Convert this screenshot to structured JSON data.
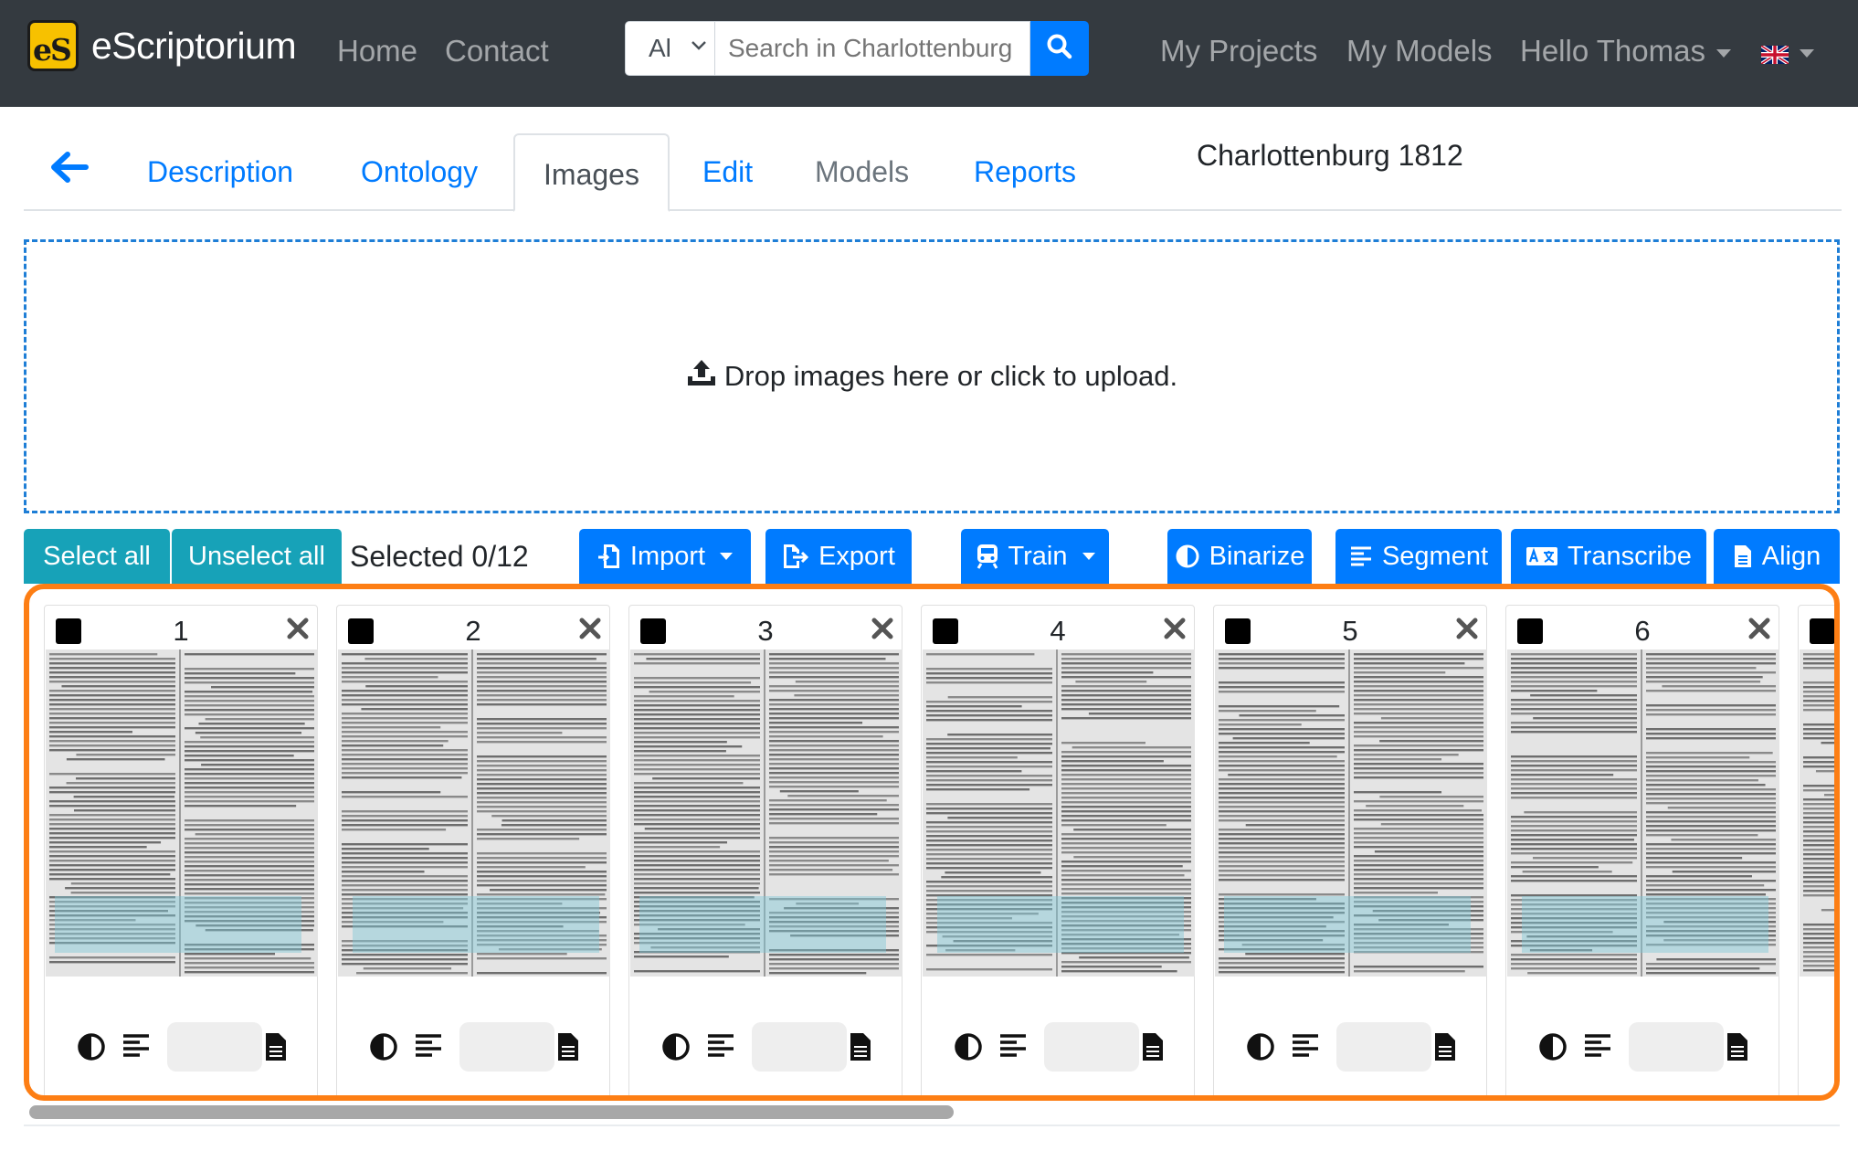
{
  "navbar": {
    "brand_logo": "eS",
    "brand": "eScriptorium",
    "links": [
      "Home",
      "Contact"
    ],
    "search": {
      "scope": "Al",
      "placeholder": "Search in Charlottenburg"
    },
    "right_links": [
      "My Projects",
      "My Models"
    ],
    "user_menu": "Hello Thomas",
    "language_flag": "uk-flag-icon"
  },
  "tabs": {
    "items": [
      "Description",
      "Ontology",
      "Images",
      "Edit",
      "Models",
      "Reports"
    ],
    "active": "Images"
  },
  "document_title": "Charlottenburg 1812",
  "dropzone": {
    "text": "Drop images here or click to upload."
  },
  "toolbar": {
    "select_all": "Select all",
    "unselect_all": "Unselect all",
    "selected": "Selected 0/12",
    "import": "Import",
    "export": "Export",
    "train": "Train",
    "binarize": "Binarize",
    "segment": "Segment",
    "transcribe": "Transcribe",
    "align": "Align"
  },
  "cards": [
    {
      "number": "1"
    },
    {
      "number": "2"
    },
    {
      "number": "3"
    },
    {
      "number": "4"
    },
    {
      "number": "5"
    },
    {
      "number": "6"
    }
  ],
  "colors": {
    "navbar": "#343a40",
    "link": "#007bff",
    "teal": "#17a2b8",
    "highlight_border": "#fd7e14",
    "dropzone_border": "#1e7ed6"
  }
}
